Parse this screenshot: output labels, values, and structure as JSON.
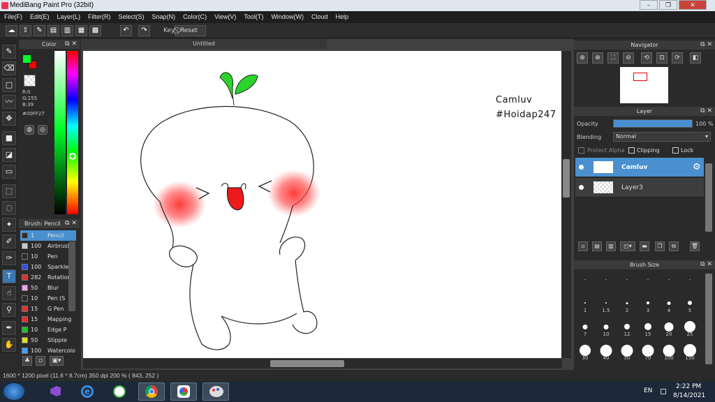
{
  "window": {
    "title": "MediBang Paint Pro (32bit)",
    "minimize": "–",
    "restore": "❐",
    "close": "✕"
  },
  "menu": [
    "File(F)",
    "Edit(E)",
    "Layer(L)",
    "Filter(R)",
    "Select(S)",
    "Snap(N)",
    "Color(C)",
    "View(V)",
    "Tool(T)",
    "Window(W)",
    "Cloud",
    "Help"
  ],
  "toolbar": {
    "key_label": "Key",
    "reset_label": "Reset"
  },
  "color_panel": {
    "title": "Color",
    "r": "R:0",
    "g": "G:255",
    "b": "B:39",
    "hex": "#00FF27",
    "fg_color": "#00FF27",
    "bg_color": "#FF0000"
  },
  "brush_panel": {
    "title": "Brush: Pencil",
    "items": [
      {
        "size": "1",
        "name": "Pencil",
        "color": "#2b2b2b"
      },
      {
        "size": "100",
        "name": "Airbrush",
        "color": "#c8c8c8"
      },
      {
        "size": "10",
        "name": "Pen",
        "color": "#2b2b2b"
      },
      {
        "size": "100",
        "name": "Sparkle",
        "color": "#3050e0"
      },
      {
        "size": "282",
        "name": "Rotation",
        "color": "#e03030"
      },
      {
        "size": "50",
        "name": "Blur",
        "color": "#f0a0f0"
      },
      {
        "size": "10",
        "name": "Pen (S",
        "color": "#2b2b2b"
      },
      {
        "size": "15",
        "name": "G Pen",
        "color": "#e03030"
      },
      {
        "size": "15",
        "name": "Mapping",
        "color": "#e03030"
      },
      {
        "size": "10",
        "name": "Edge P",
        "color": "#20c030"
      },
      {
        "size": "50",
        "name": "Stipple",
        "color": "#e0e020"
      },
      {
        "size": "100",
        "name": "Watercolor",
        "color": "#40a0ff"
      }
    ]
  },
  "canvas": {
    "tab_title": "Untitled",
    "text_line1": "Camluv",
    "text_line2": "#Hoidap247"
  },
  "navigator": {
    "title": "Navigator"
  },
  "layer_panel": {
    "title": "Layer",
    "opacity_label": "Opacity",
    "opacity_value": "100 %",
    "opacity_percent": 100,
    "blending_label": "Blending",
    "blending_value": "Normal",
    "protect_alpha": "Protect Alpha",
    "clipping": "Clipping",
    "lock": "Lock",
    "layers": [
      {
        "name": "Camluv",
        "selected": true
      },
      {
        "name": "Layer3",
        "selected": false
      }
    ]
  },
  "brush_size": {
    "title": "Brush Size",
    "sizes": [
      "",
      "",
      "",
      "",
      "",
      "",
      "1",
      "1.5",
      "2",
      "3",
      "4",
      "5",
      "7",
      "10",
      "12",
      "15",
      "20",
      "25",
      "30",
      "40",
      "50",
      "70",
      "100",
      "150"
    ]
  },
  "status": {
    "text": "1600 * 1200 pixel   (11.6 * 8.7cm)   350 dpi   200 %   ( 843, 252 )"
  },
  "taskbar": {
    "lang": "EN",
    "time": "2:22 PM",
    "date": "8/14/2021"
  }
}
